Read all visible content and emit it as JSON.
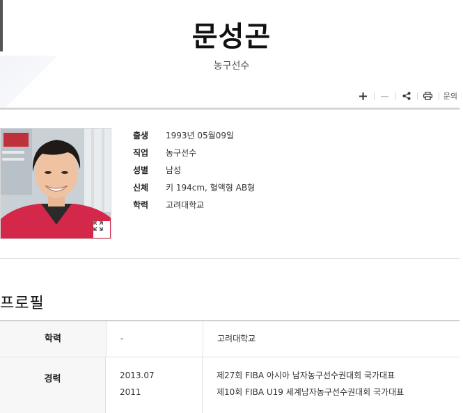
{
  "header": {
    "title": "문성곤",
    "subtitle": "농구선수"
  },
  "toolbar": {
    "buttons": [
      {
        "name": "plus-icon"
      },
      {
        "name": "minus-icon"
      },
      {
        "name": "share-icon"
      },
      {
        "name": "print-icon"
      }
    ],
    "inquiry_label": "문의"
  },
  "info": {
    "rows": [
      {
        "label": "출생",
        "value": "1993년 05월09일"
      },
      {
        "label": "직업",
        "value": "농구선수"
      },
      {
        "label": "성별",
        "value": "남성"
      },
      {
        "label": "신체",
        "value": "키 194cm, 혈액형 AB형"
      },
      {
        "label": "학력",
        "value": "고려대학교"
      }
    ]
  },
  "profile": {
    "section_title": "프로필",
    "rows": [
      {
        "label": "학력",
        "years": [
          "-"
        ],
        "items": [
          "고려대학교"
        ]
      },
      {
        "label": "경력",
        "years": [
          "2013.07",
          "2011"
        ],
        "items": [
          "제27회 FIBA 아시아 남자농구선수권대회 국가대표",
          "제10회 FIBA U19 세계남자농구선수권대회 국가대표"
        ]
      }
    ]
  },
  "colors": {
    "title": "#111111",
    "rule": "#999999",
    "header_cell_bg": "#f7f7f7",
    "shirt": "#d4284a"
  }
}
